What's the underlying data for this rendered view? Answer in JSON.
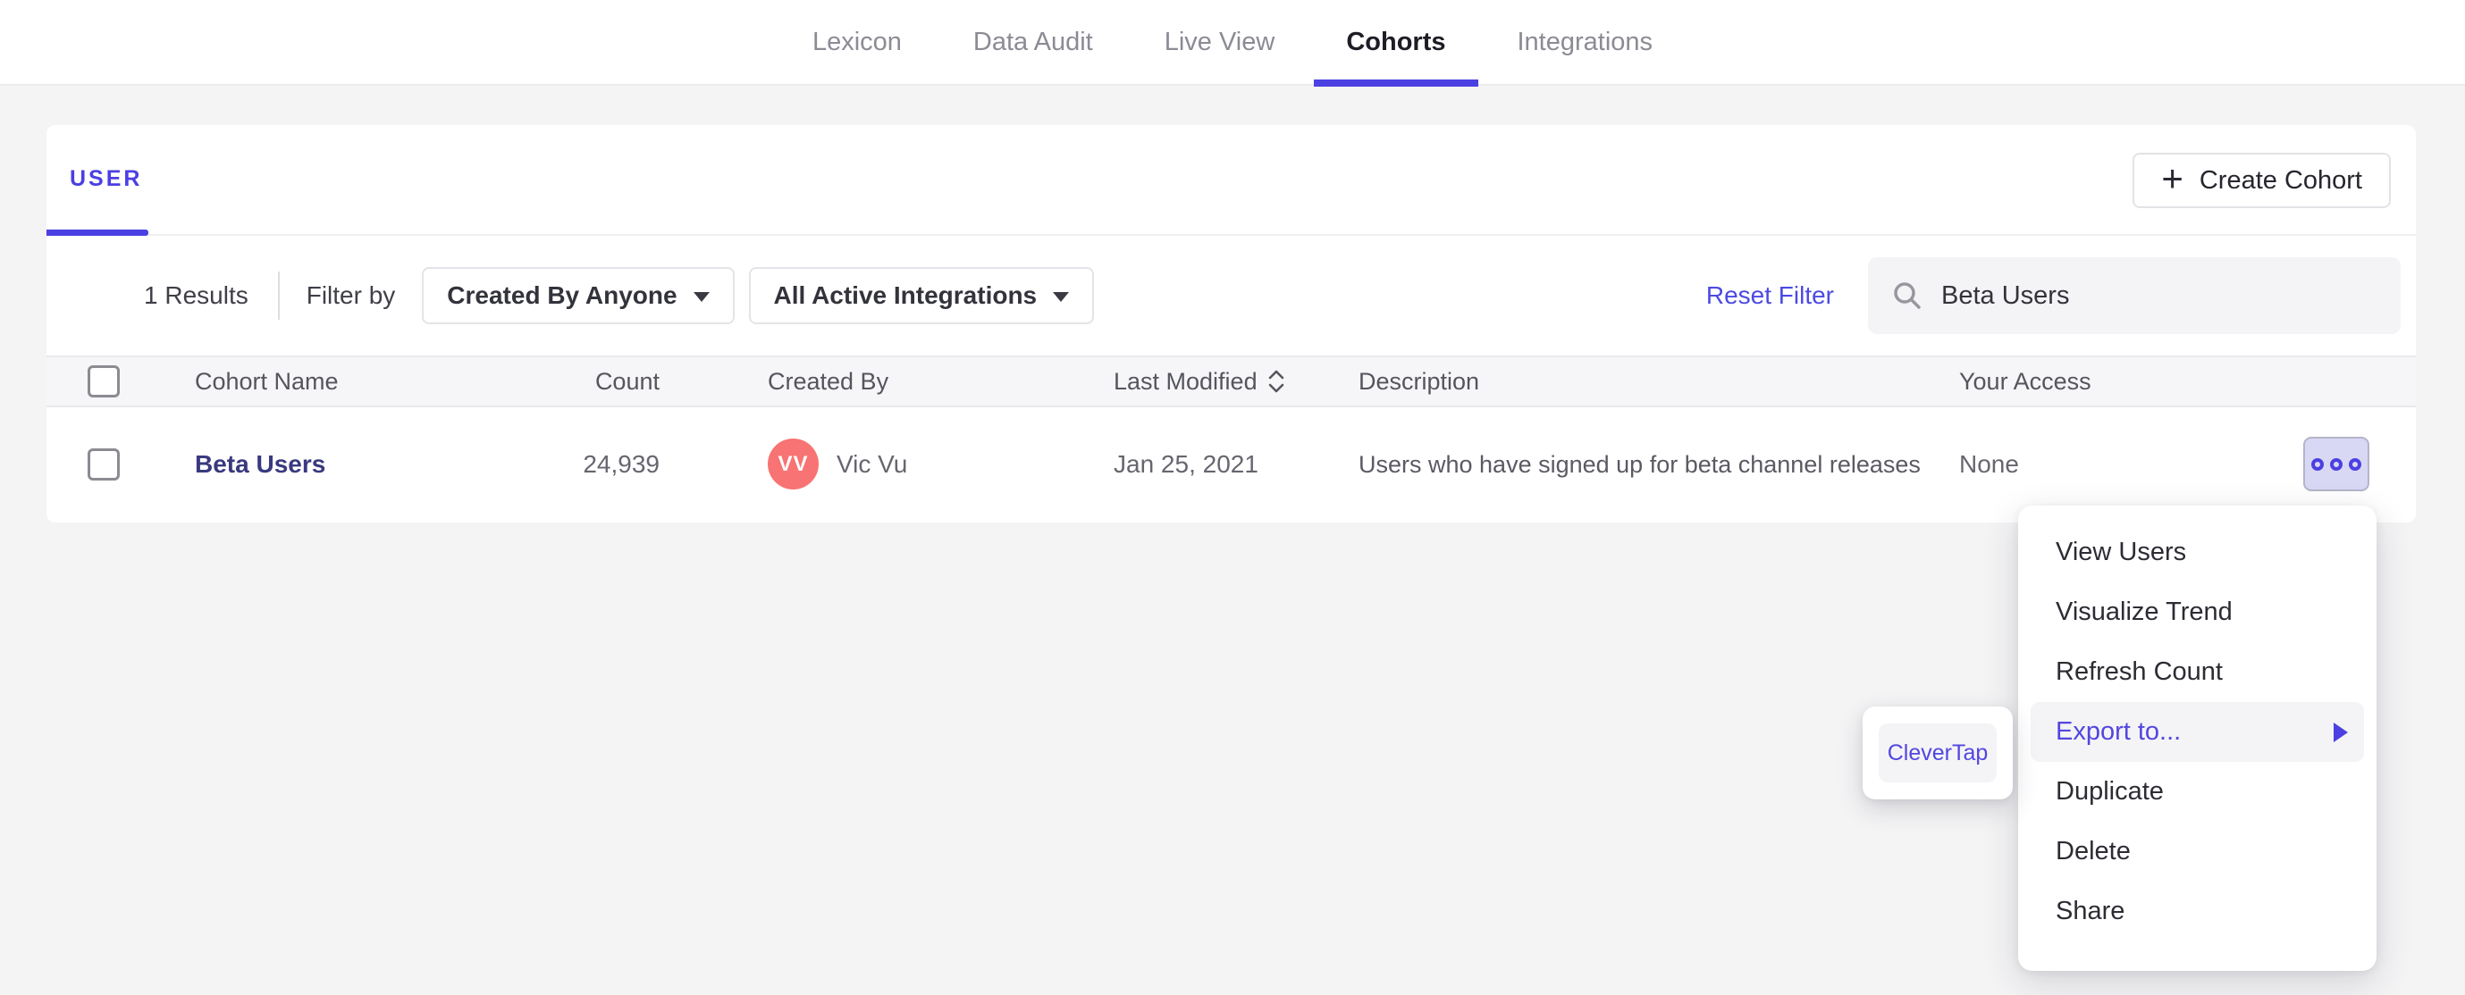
{
  "colors": {
    "accent": "#4B40E2",
    "link": "#39397F",
    "avatar": "#F87373",
    "highlight_bg": "#F4F4F6",
    "page_bg": "#F4F4F5"
  },
  "nav": {
    "items": [
      {
        "label": "Lexicon",
        "active": false
      },
      {
        "label": "Data Audit",
        "active": false
      },
      {
        "label": "Live View",
        "active": false
      },
      {
        "label": "Cohorts",
        "active": true
      },
      {
        "label": "Integrations",
        "active": false
      }
    ]
  },
  "panel": {
    "tab_label": "USER",
    "create_button_label": "Create Cohort",
    "plus_icon": "+"
  },
  "filter_bar": {
    "results": "1 Results",
    "filter_by": "Filter by",
    "created_by_dropdown": "Created By Anyone",
    "integrations_dropdown": "All Active Integrations",
    "reset": "Reset Filter",
    "search": {
      "value": "Beta Users"
    }
  },
  "table": {
    "headers": {
      "name": "Cohort Name",
      "count": "Count",
      "created_by": "Created By",
      "last_modified": "Last Modified",
      "description": "Description",
      "access": "Your Access"
    },
    "rows": [
      {
        "name": "Beta Users",
        "count": "24,939",
        "avatar_initials": "VV",
        "created_by": "Vic Vu",
        "last_modified": "Jan 25, 2021",
        "description": "Users who have signed up for beta channel releases",
        "access": "None"
      }
    ]
  },
  "context_menu": {
    "items": [
      {
        "label": "View Users"
      },
      {
        "label": "Visualize Trend"
      },
      {
        "label": "Refresh Count"
      },
      {
        "label": "Export to...",
        "highlighted": true,
        "has_submenu": true
      },
      {
        "label": "Duplicate"
      },
      {
        "label": "Delete"
      },
      {
        "label": "Share"
      }
    ]
  },
  "export_submenu": {
    "items": [
      {
        "label": "CleverTap"
      }
    ]
  }
}
